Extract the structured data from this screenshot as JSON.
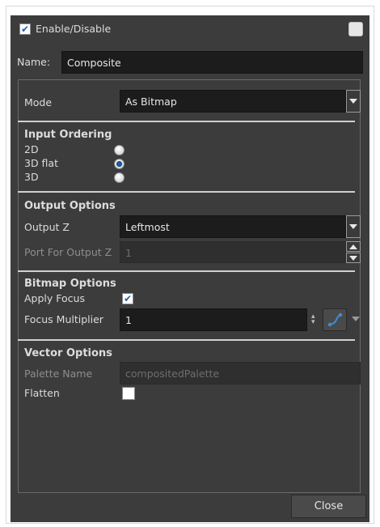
{
  "header": {
    "enable_label": "Enable/Disable",
    "enable_checked": true,
    "color_swatch": "#e6e6e6"
  },
  "name_row": {
    "label": "Name:",
    "value": "Composite"
  },
  "mode": {
    "label": "Mode",
    "value": "As Bitmap"
  },
  "input_ordering": {
    "heading": "Input Ordering",
    "options": [
      {
        "label": "2D",
        "selected": false
      },
      {
        "label": "3D flat",
        "selected": true
      },
      {
        "label": "3D",
        "selected": false
      }
    ]
  },
  "output_options": {
    "heading": "Output Options",
    "output_z_label": "Output Z",
    "output_z_value": "Leftmost",
    "port_label": "Port For Output Z",
    "port_value": "1"
  },
  "bitmap_options": {
    "heading": "Bitmap Options",
    "apply_focus_label": "Apply Focus",
    "apply_focus_checked": true,
    "focus_multiplier_label": "Focus Multiplier",
    "focus_multiplier_value": "1"
  },
  "vector_options": {
    "heading": "Vector Options",
    "palette_label": "Palette Name",
    "palette_value": "compositedPalette",
    "flatten_label": "Flatten",
    "flatten_checked": false
  },
  "footer": {
    "close_label": "Close"
  },
  "colors": {
    "dialog_bg": "#3c3c3c",
    "field_bg": "#1c1c1c",
    "accent": "#1d5ea8"
  }
}
